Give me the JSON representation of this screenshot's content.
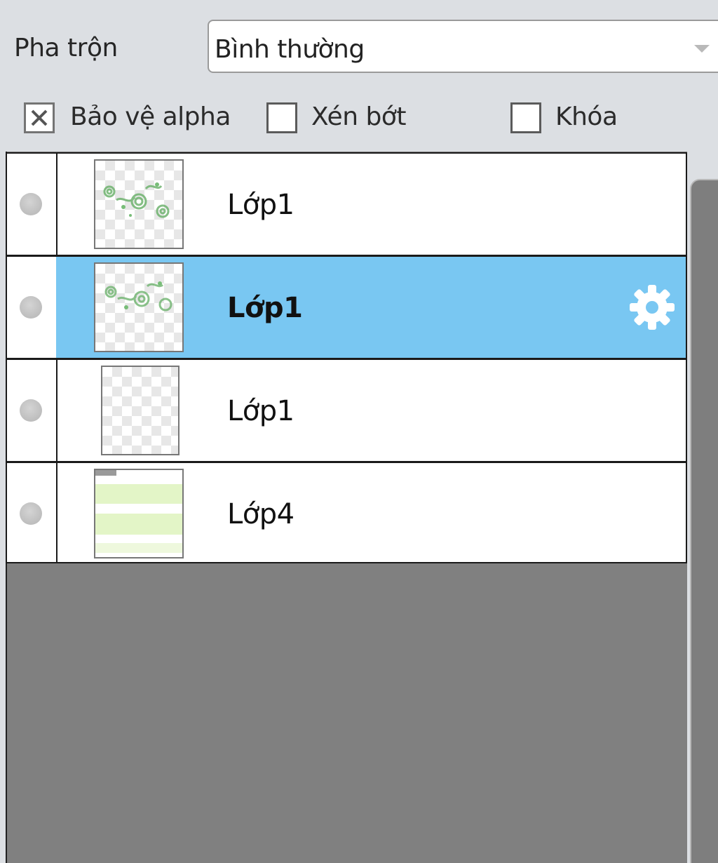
{
  "blend": {
    "label": "Pha trộn",
    "value": "Bình thường"
  },
  "options": {
    "protect_alpha": {
      "label": "Bảo vệ alpha",
      "checked": true
    },
    "clip": {
      "label": "Xén bớt",
      "checked": false
    },
    "lock": {
      "label": "Khóa",
      "checked": false
    }
  },
  "layers": [
    {
      "name": "Lớp1",
      "selected": false,
      "thumbnail": "green-swirls"
    },
    {
      "name": "Lớp1",
      "selected": true,
      "thumbnail": "green-swirls",
      "settings_icon": "gear-icon"
    },
    {
      "name": "Lớp1",
      "selected": false,
      "thumbnail": "transparent"
    },
    {
      "name": "Lớp4",
      "selected": false,
      "thumbnail": "light-green-stripes"
    }
  ],
  "colors": {
    "selection": "#79c7f2",
    "panel_bg": "#dcdfe3",
    "empty_area": "#808080"
  }
}
